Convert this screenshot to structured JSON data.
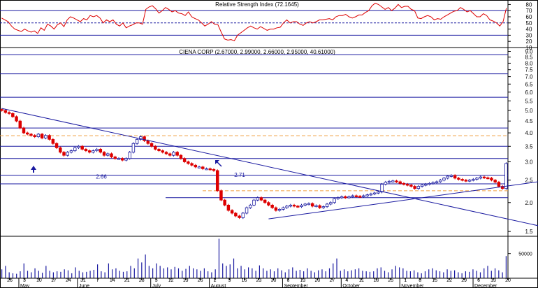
{
  "chart_data": [
    {
      "type": "line",
      "panel": "rsi",
      "title": "Relative Strength Index (72.1645)",
      "yticks": [
        10,
        20,
        30,
        40,
        50,
        60,
        70,
        80
      ],
      "ylim": [
        10,
        85
      ],
      "reference_lines": [
        30,
        50,
        70
      ],
      "series": [
        {
          "color": "#dd0000",
          "values": [
            58,
            55,
            52,
            45,
            40,
            38,
            36,
            40,
            37,
            35,
            37,
            33,
            42,
            38,
            48,
            45,
            40,
            47,
            50,
            44,
            55,
            60,
            58,
            55,
            52,
            57,
            55,
            62,
            60,
            62,
            58,
            50,
            55,
            52,
            55,
            48,
            45,
            50,
            42,
            45,
            47,
            50,
            50,
            48,
            72,
            76,
            78,
            73,
            66,
            70,
            75,
            72,
            68,
            70,
            66,
            65,
            62,
            68,
            60,
            57,
            55,
            50,
            45,
            48,
            52,
            48,
            47,
            35,
            24,
            22,
            23,
            21,
            30,
            34,
            38,
            42,
            45,
            42,
            40,
            44,
            41,
            38,
            40,
            40,
            42,
            43,
            50,
            55,
            50,
            52,
            52,
            48,
            46,
            50,
            52,
            50,
            52,
            55,
            55,
            56,
            57,
            55,
            60,
            62,
            62,
            64,
            60,
            58,
            60,
            63,
            63,
            67,
            70,
            78,
            82,
            80,
            76,
            72,
            75,
            70,
            74,
            80,
            75,
            77,
            77,
            72,
            70,
            58,
            57,
            60,
            62,
            60,
            55,
            57,
            56,
            60,
            63,
            66,
            69,
            70,
            75,
            72,
            68,
            70,
            65,
            60,
            60,
            65,
            62,
            55,
            53,
            50,
            45,
            52,
            74
          ]
        }
      ]
    },
    {
      "type": "candlestick",
      "panel": "price",
      "title": "CIENA CORP (2.67000, 2.99000, 2.66000, 2.95000, 40.61000)",
      "scale": "log",
      "yticks": [
        1.5,
        2.0,
        2.5,
        3.0,
        3.5,
        4.0,
        4.5,
        5.0,
        5.5,
        6.0,
        6.5,
        7.0,
        7.5,
        8.0,
        8.5,
        9.0
      ],
      "ylim": [
        1.43,
        9.35
      ],
      "x_tick_labels": [
        "26",
        "3",
        "10",
        "17",
        "24",
        "31",
        "7",
        "14",
        "21",
        "28",
        "5",
        "12",
        "19",
        "26",
        "2",
        "9",
        "16",
        "23",
        "30",
        "6",
        "13",
        "20",
        "27",
        "4",
        "11",
        "18",
        "25",
        "1",
        "8",
        "15",
        "22",
        "29",
        "6",
        "13",
        "20"
      ],
      "month_labels": [
        "May",
        "June",
        "July",
        "August",
        "September",
        "October",
        "November",
        "December"
      ],
      "horizontal_levels": [
        2.1,
        2.41,
        2.62,
        3.1,
        3.5,
        4.2,
        5.7,
        7.2,
        8.7
      ],
      "dashed_levels": [
        2.25,
        3.89
      ],
      "annotations": [
        "2.66",
        "2.71"
      ],
      "trendlines": [
        {
          "from": [
            0,
            5.1
          ],
          "to": [
            154,
            1.5
          ]
        },
        {
          "from": [
            73,
            1.7
          ],
          "to": [
            150,
            2.5
          ]
        }
      ],
      "closes": [
        5.0,
        4.9,
        4.85,
        4.7,
        4.5,
        4.2,
        4.0,
        3.95,
        3.9,
        3.85,
        3.95,
        3.8,
        3.9,
        3.75,
        3.6,
        3.45,
        3.3,
        3.2,
        3.3,
        3.35,
        3.45,
        3.5,
        3.4,
        3.35,
        3.3,
        3.35,
        3.4,
        3.3,
        3.2,
        3.25,
        3.15,
        3.1,
        3.1,
        3.05,
        3.1,
        3.3,
        3.6,
        3.75,
        3.85,
        3.7,
        3.6,
        3.5,
        3.4,
        3.35,
        3.3,
        3.25,
        3.2,
        3.3,
        3.2,
        3.1,
        3.0,
        2.95,
        2.9,
        2.85,
        2.85,
        2.8,
        2.8,
        2.78,
        2.75,
        2.25,
        2.05,
        1.95,
        1.85,
        1.8,
        1.75,
        1.72,
        1.8,
        1.9,
        1.95,
        2.05,
        2.1,
        2.05,
        2.0,
        1.95,
        1.9,
        1.85,
        1.87,
        1.9,
        1.93,
        1.95,
        1.93,
        1.92,
        1.95,
        1.97,
        1.98,
        1.93,
        1.94,
        1.9,
        1.92,
        1.97,
        2.0,
        2.08,
        2.1,
        2.12,
        2.1,
        2.12,
        2.14,
        2.13,
        2.12,
        2.14,
        2.16,
        2.18,
        2.2,
        2.22,
        2.4,
        2.45,
        2.47,
        2.48,
        2.46,
        2.42,
        2.4,
        2.38,
        2.35,
        2.3,
        2.35,
        2.38,
        2.4,
        2.42,
        2.44,
        2.46,
        2.5,
        2.55,
        2.6,
        2.62,
        2.55,
        2.52,
        2.5,
        2.48,
        2.5,
        2.52,
        2.55,
        2.58,
        2.56,
        2.55,
        2.5,
        2.45,
        2.35,
        2.3,
        2.95
      ]
    },
    {
      "type": "bar",
      "panel": "volume",
      "yticks": [
        50000
      ],
      "ylim": [
        0,
        85000
      ],
      "values": [
        18000,
        25000,
        12000,
        10000,
        9000,
        14000,
        30000,
        15000,
        12000,
        20000,
        15000,
        11000,
        25000,
        15000,
        12000,
        14000,
        13000,
        18000,
        16000,
        10000,
        22000,
        15000,
        12000,
        13000,
        15000,
        17000,
        28000,
        14000,
        12000,
        30000,
        18000,
        20000,
        15000,
        13000,
        14000,
        25000,
        20000,
        40000,
        32000,
        48000,
        25000,
        20000,
        30000,
        25000,
        20000,
        22000,
        18000,
        23000,
        20000,
        15000,
        19000,
        25000,
        20000,
        18000,
        15000,
        20000,
        14000,
        12000,
        18000,
        80000,
        30000,
        25000,
        28000,
        40000,
        20000,
        25000,
        18000,
        22000,
        20000,
        15000,
        26000,
        20000,
        15000,
        18000,
        14000,
        20000,
        16000,
        12000,
        18000,
        22000,
        15000,
        17000,
        14000,
        20000,
        15000,
        12000,
        16000,
        18000,
        14000,
        20000,
        30000,
        40000,
        15000,
        18000,
        14000,
        16000,
        18000,
        20000,
        15000,
        14000,
        13000,
        14000,
        20000,
        22000,
        15000,
        12000,
        18000,
        25000,
        22000,
        20000,
        15000,
        14000,
        16000,
        12000,
        10000,
        14000,
        18000,
        20000,
        16000,
        14000,
        12000,
        18000,
        15000,
        16000,
        12000,
        10000,
        14000,
        13000,
        18000,
        15000,
        12000,
        20000,
        25000,
        15000,
        20000,
        16000,
        12000,
        45000
      ]
    }
  ]
}
